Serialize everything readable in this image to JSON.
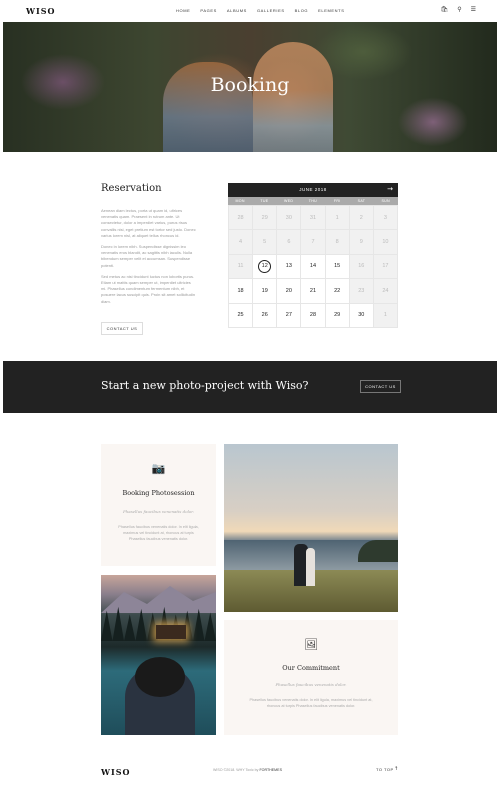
{
  "header": {
    "logo": "WISO",
    "nav": [
      "HOME",
      "PAGES",
      "ALBUMS",
      "GALLERIES",
      "BLOG",
      "ELEMENTS"
    ],
    "icons": [
      "bag-icon",
      "search-icon",
      "menu-icon"
    ]
  },
  "hero": {
    "title": "Booking"
  },
  "reservation": {
    "title": "Reservation",
    "paragraphs": [
      "Aenean diam lectus, porta ut quam id, ultrices venenatis quam. Praesent in rutrum ante. Ut consectetur, dolor a imperdiet varius, purus risus convallis nisi, eget pretium est tortor sed justo. Donec varius lorem nisl, at aliquet tellus rhoncus id.",
      "Donec in lorem nibh. Suspendisse dignissim leo venenatis eros blandit, ac sagittis nibh iaculis. Nulla bibendum semper velit et accumsan. Suspendisse potenti.",
      "Sed metus ac nisi tincidunt luctus non lobortis purus. Etiam ut mattis quam semper ut, imperdiet ultricies mi. Phasellus condimentum fermentum nibh, et posuere lacus suscipit quis. Proin sit amet sollicitudin diam."
    ],
    "button": "CONTACT US"
  },
  "calendar": {
    "month": "JUNE 2018",
    "next": "→",
    "weekdays": [
      "MON",
      "TUE",
      "WED",
      "THU",
      "FRI",
      "SAT",
      "SUN"
    ],
    "days": [
      {
        "d": "28",
        "muted": true
      },
      {
        "d": "29",
        "muted": true
      },
      {
        "d": "30",
        "muted": true
      },
      {
        "d": "31",
        "muted": true
      },
      {
        "d": "1",
        "muted": true
      },
      {
        "d": "2",
        "muted": true
      },
      {
        "d": "3",
        "muted": true
      },
      {
        "d": "4",
        "muted": true
      },
      {
        "d": "5",
        "muted": true
      },
      {
        "d": "6",
        "muted": true
      },
      {
        "d": "7",
        "muted": true
      },
      {
        "d": "8",
        "muted": true
      },
      {
        "d": "9",
        "muted": true
      },
      {
        "d": "10",
        "muted": true
      },
      {
        "d": "11",
        "muted": true
      },
      {
        "d": "12",
        "muted": false,
        "today": true
      },
      {
        "d": "13",
        "muted": false
      },
      {
        "d": "14",
        "muted": false
      },
      {
        "d": "15",
        "muted": false
      },
      {
        "d": "16",
        "muted": true
      },
      {
        "d": "17",
        "muted": true
      },
      {
        "d": "18",
        "muted": false
      },
      {
        "d": "19",
        "muted": false
      },
      {
        "d": "20",
        "muted": false
      },
      {
        "d": "21",
        "muted": false
      },
      {
        "d": "22",
        "muted": false
      },
      {
        "d": "23",
        "muted": true
      },
      {
        "d": "24",
        "muted": true
      },
      {
        "d": "25",
        "muted": false
      },
      {
        "d": "26",
        "muted": false
      },
      {
        "d": "27",
        "muted": false
      },
      {
        "d": "28",
        "muted": false
      },
      {
        "d": "29",
        "muted": false
      },
      {
        "d": "30",
        "muted": false
      },
      {
        "d": "1",
        "muted": true
      }
    ]
  },
  "banner": {
    "text": "Start a new photo-project with Wiso?",
    "button": "CONTACT US"
  },
  "card_booking": {
    "icon": "camera-icon",
    "title": "Booking Photosession",
    "subtitle": "Phasellus faucibus venenatis dolor.",
    "text": "Phasellus faucibus venenatis dolor. In elit ligula, maximus vel tincidunt at, rhoncus at turpis Phasellus faucibus venenatis dolor."
  },
  "card_commitment": {
    "icon": "image-icon",
    "title": "Our Commitment",
    "subtitle": "Phasellus faucibus venenatis dolor.",
    "text": "Phasellus faucibus venenatis dolor. In elit ligula, maximus vel tincidunt at, rhoncus at turpis Phasellus faucibus venenatis dolor."
  },
  "footer": {
    "logo": "WISO",
    "copy_prefix": "WISO ©2018. WHY Toxic by",
    "copy_brand": "FORTHEMES",
    "to_top": "TO TOP",
    "to_top_icon": "↑"
  },
  "colors": {
    "dark": "#222222",
    "card_bg": "#faf6f3",
    "muted_text": "#999999"
  }
}
